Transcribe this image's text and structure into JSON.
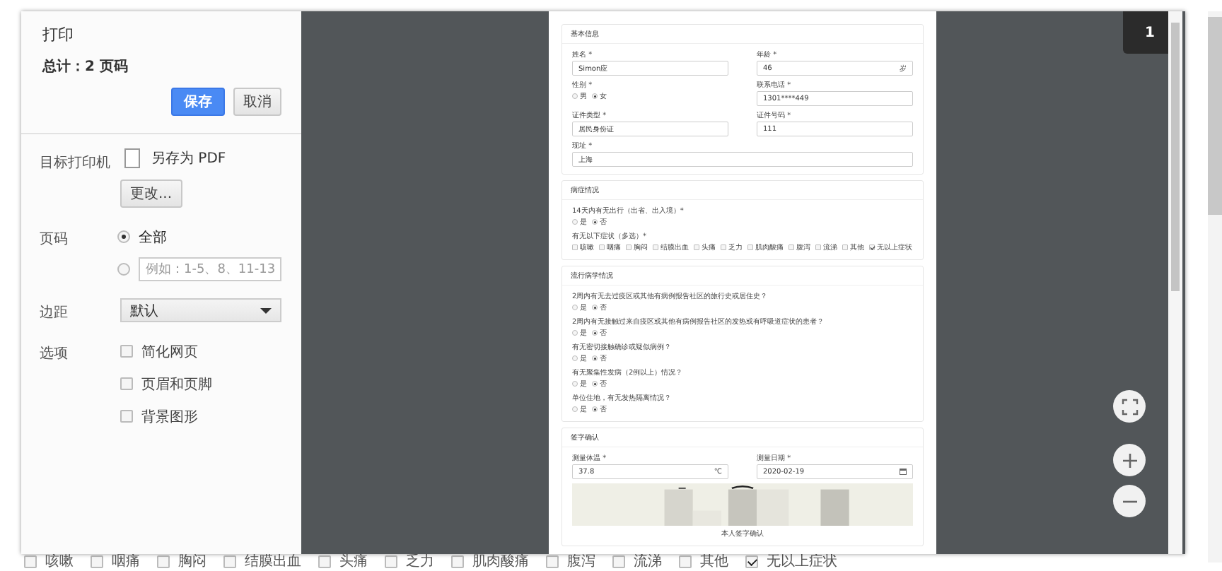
{
  "background_page": {
    "symptom_options": [
      {
        "label": "咳嗽",
        "checked": false
      },
      {
        "label": "咽痛",
        "checked": false
      },
      {
        "label": "胸闷",
        "checked": false
      },
      {
        "label": "结膜出血",
        "checked": false
      },
      {
        "label": "头痛",
        "checked": false
      },
      {
        "label": "乏力",
        "checked": false
      },
      {
        "label": "肌肉酸痛",
        "checked": false
      },
      {
        "label": "腹泻",
        "checked": false
      },
      {
        "label": "流涕",
        "checked": false
      },
      {
        "label": "其他",
        "checked": false
      },
      {
        "label": "无以上症状",
        "checked": true
      }
    ]
  },
  "dialog": {
    "title": "打印",
    "total": "总计：2 页码",
    "buttons": [
      {
        "label": "保存",
        "kind": "primary"
      },
      {
        "label": "取消",
        "kind": "secondary"
      }
    ],
    "settings": [
      {
        "label": "目标打印机",
        "kind": "destination",
        "destination": "另存为 PDF",
        "button": "更改..."
      },
      {
        "label": "页码",
        "kind": "pages",
        "options": [
          {
            "label": "全部",
            "selected": true
          },
          {
            "placeholder": "例如：1-5、8、11-13",
            "selected": false
          }
        ]
      },
      {
        "label": "边距",
        "kind": "select",
        "value": "默认"
      },
      {
        "label": "选项",
        "kind": "checks",
        "options": [
          {
            "label": "简化网页",
            "checked": false
          },
          {
            "label": "页眉和页脚",
            "checked": false
          },
          {
            "label": "背景图形",
            "checked": false
          }
        ]
      }
    ]
  },
  "preview": {
    "page_badge": "1",
    "document": {
      "sections": [
        {
          "title": "基本信息",
          "rows": [
            [
              {
                "kind": "input",
                "label": "姓名 *",
                "value": "Simon应"
              },
              {
                "kind": "input",
                "label": "年龄 *",
                "value": "46",
                "suffix": "岁"
              }
            ],
            [
              {
                "kind": "radio",
                "label": "性别 *",
                "options": [
                  {
                    "label": "男",
                    "selected": false
                  },
                  {
                    "label": "女",
                    "selected": true
                  }
                ]
              },
              {
                "kind": "input",
                "label": "联系电话 *",
                "value": "1301****449"
              }
            ],
            [
              {
                "kind": "input",
                "label": "证件类型 *",
                "value": "居民身份证"
              },
              {
                "kind": "input",
                "label": "证件号码 *",
                "value": "111"
              }
            ],
            [
              {
                "kind": "input",
                "label": "现址 *",
                "value": "上海"
              }
            ]
          ]
        },
        {
          "title": "病症情况",
          "rows": [
            [
              {
                "kind": "radio",
                "label": "14天内有无出行（出省、出入境）*",
                "options": [
                  {
                    "label": "是",
                    "selected": false
                  },
                  {
                    "label": "否",
                    "selected": true
                  }
                ]
              }
            ],
            [
              {
                "kind": "checks",
                "label": "有无以下症状（多选）*",
                "options": [
                  {
                    "label": "咳嗽",
                    "checked": false
                  },
                  {
                    "label": "咽痛",
                    "checked": false
                  },
                  {
                    "label": "胸闷",
                    "checked": false
                  },
                  {
                    "label": "结膜出血",
                    "checked": false
                  },
                  {
                    "label": "头痛",
                    "checked": false
                  },
                  {
                    "label": "乏力",
                    "checked": false
                  },
                  {
                    "label": "肌肉酸痛",
                    "checked": false
                  },
                  {
                    "label": "腹泻",
                    "checked": false
                  },
                  {
                    "label": "流涕",
                    "checked": false
                  },
                  {
                    "label": "其他",
                    "checked": false
                  },
                  {
                    "label": "无以上症状",
                    "checked": true
                  }
                ]
              }
            ]
          ]
        },
        {
          "title": "流行病学情况",
          "rows": [
            [
              {
                "kind": "radio",
                "label": "2周内有无去过疫区或其他有病例报告社区的旅行史或居住史？",
                "options": [
                  {
                    "label": "是",
                    "selected": false
                  },
                  {
                    "label": "否",
                    "selected": true
                  }
                ]
              }
            ],
            [
              {
                "kind": "radio",
                "label": "2周内有无接触过来自疫区或其他有病例报告社区的发热或有呼吸道症状的患者？",
                "options": [
                  {
                    "label": "是",
                    "selected": false
                  },
                  {
                    "label": "否",
                    "selected": true
                  }
                ]
              }
            ],
            [
              {
                "kind": "radio",
                "label": "有无密切接触确诊或疑似病例？",
                "options": [
                  {
                    "label": "是",
                    "selected": false
                  },
                  {
                    "label": "否",
                    "selected": true
                  }
                ]
              }
            ],
            [
              {
                "kind": "radio",
                "label": "有无聚集性发病（2例以上）情况？",
                "options": [
                  {
                    "label": "是",
                    "selected": false
                  },
                  {
                    "label": "否",
                    "selected": true
                  }
                ]
              }
            ],
            [
              {
                "kind": "radio",
                "label": "单位住地，有无发热隔离情况？",
                "options": [
                  {
                    "label": "是",
                    "selected": false
                  },
                  {
                    "label": "否",
                    "selected": true
                  }
                ]
              }
            ]
          ]
        },
        {
          "title": "签字确认",
          "rows": [
            [
              {
                "kind": "input",
                "label": "测量体温 *",
                "value": "37.8",
                "suffix": "℃"
              },
              {
                "kind": "date",
                "label": "测量日期 *",
                "value": "2020-02-19"
              }
            ],
            [
              {
                "kind": "signature",
                "caption": "本人签字确认"
              }
            ]
          ]
        }
      ]
    }
  }
}
